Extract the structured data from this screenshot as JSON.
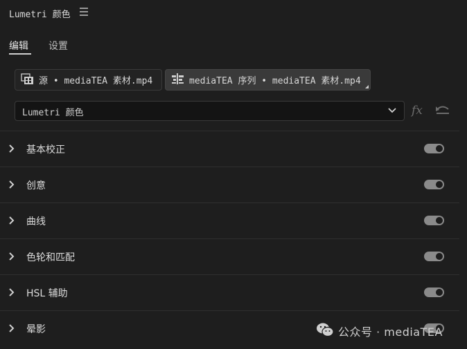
{
  "header": {
    "title": "Lumetri 颜色",
    "menu_icon": "hamburger-menu-icon"
  },
  "tabs": [
    {
      "label": "编辑",
      "active": true
    },
    {
      "label": "设置",
      "active": false
    }
  ],
  "sources": {
    "source_clip": "源 • mediaTEA 素材.mp4",
    "sequence_clip": "mediaTEA 序列 • mediaTEA 素材.mp4"
  },
  "effect_dropdown": {
    "selected": "Lumetri 颜色"
  },
  "toolbar": {
    "fx_label": "fx",
    "reset_icon": "reset-icon"
  },
  "sections": [
    {
      "label": "基本校正",
      "enabled": true
    },
    {
      "label": "创意",
      "enabled": true
    },
    {
      "label": "曲线",
      "enabled": true
    },
    {
      "label": "色轮和匹配",
      "enabled": true
    },
    {
      "label": "HSL 辅助",
      "enabled": true
    },
    {
      "label": "晕影",
      "enabled": true
    }
  ],
  "watermark": {
    "text": "公众号 · mediaTEA",
    "icon": "wechat-icon"
  },
  "colors": {
    "background": "#1e1e1e",
    "toggle_on": "#8a8a8a",
    "active_tab_underline": "#d0d0d0"
  }
}
